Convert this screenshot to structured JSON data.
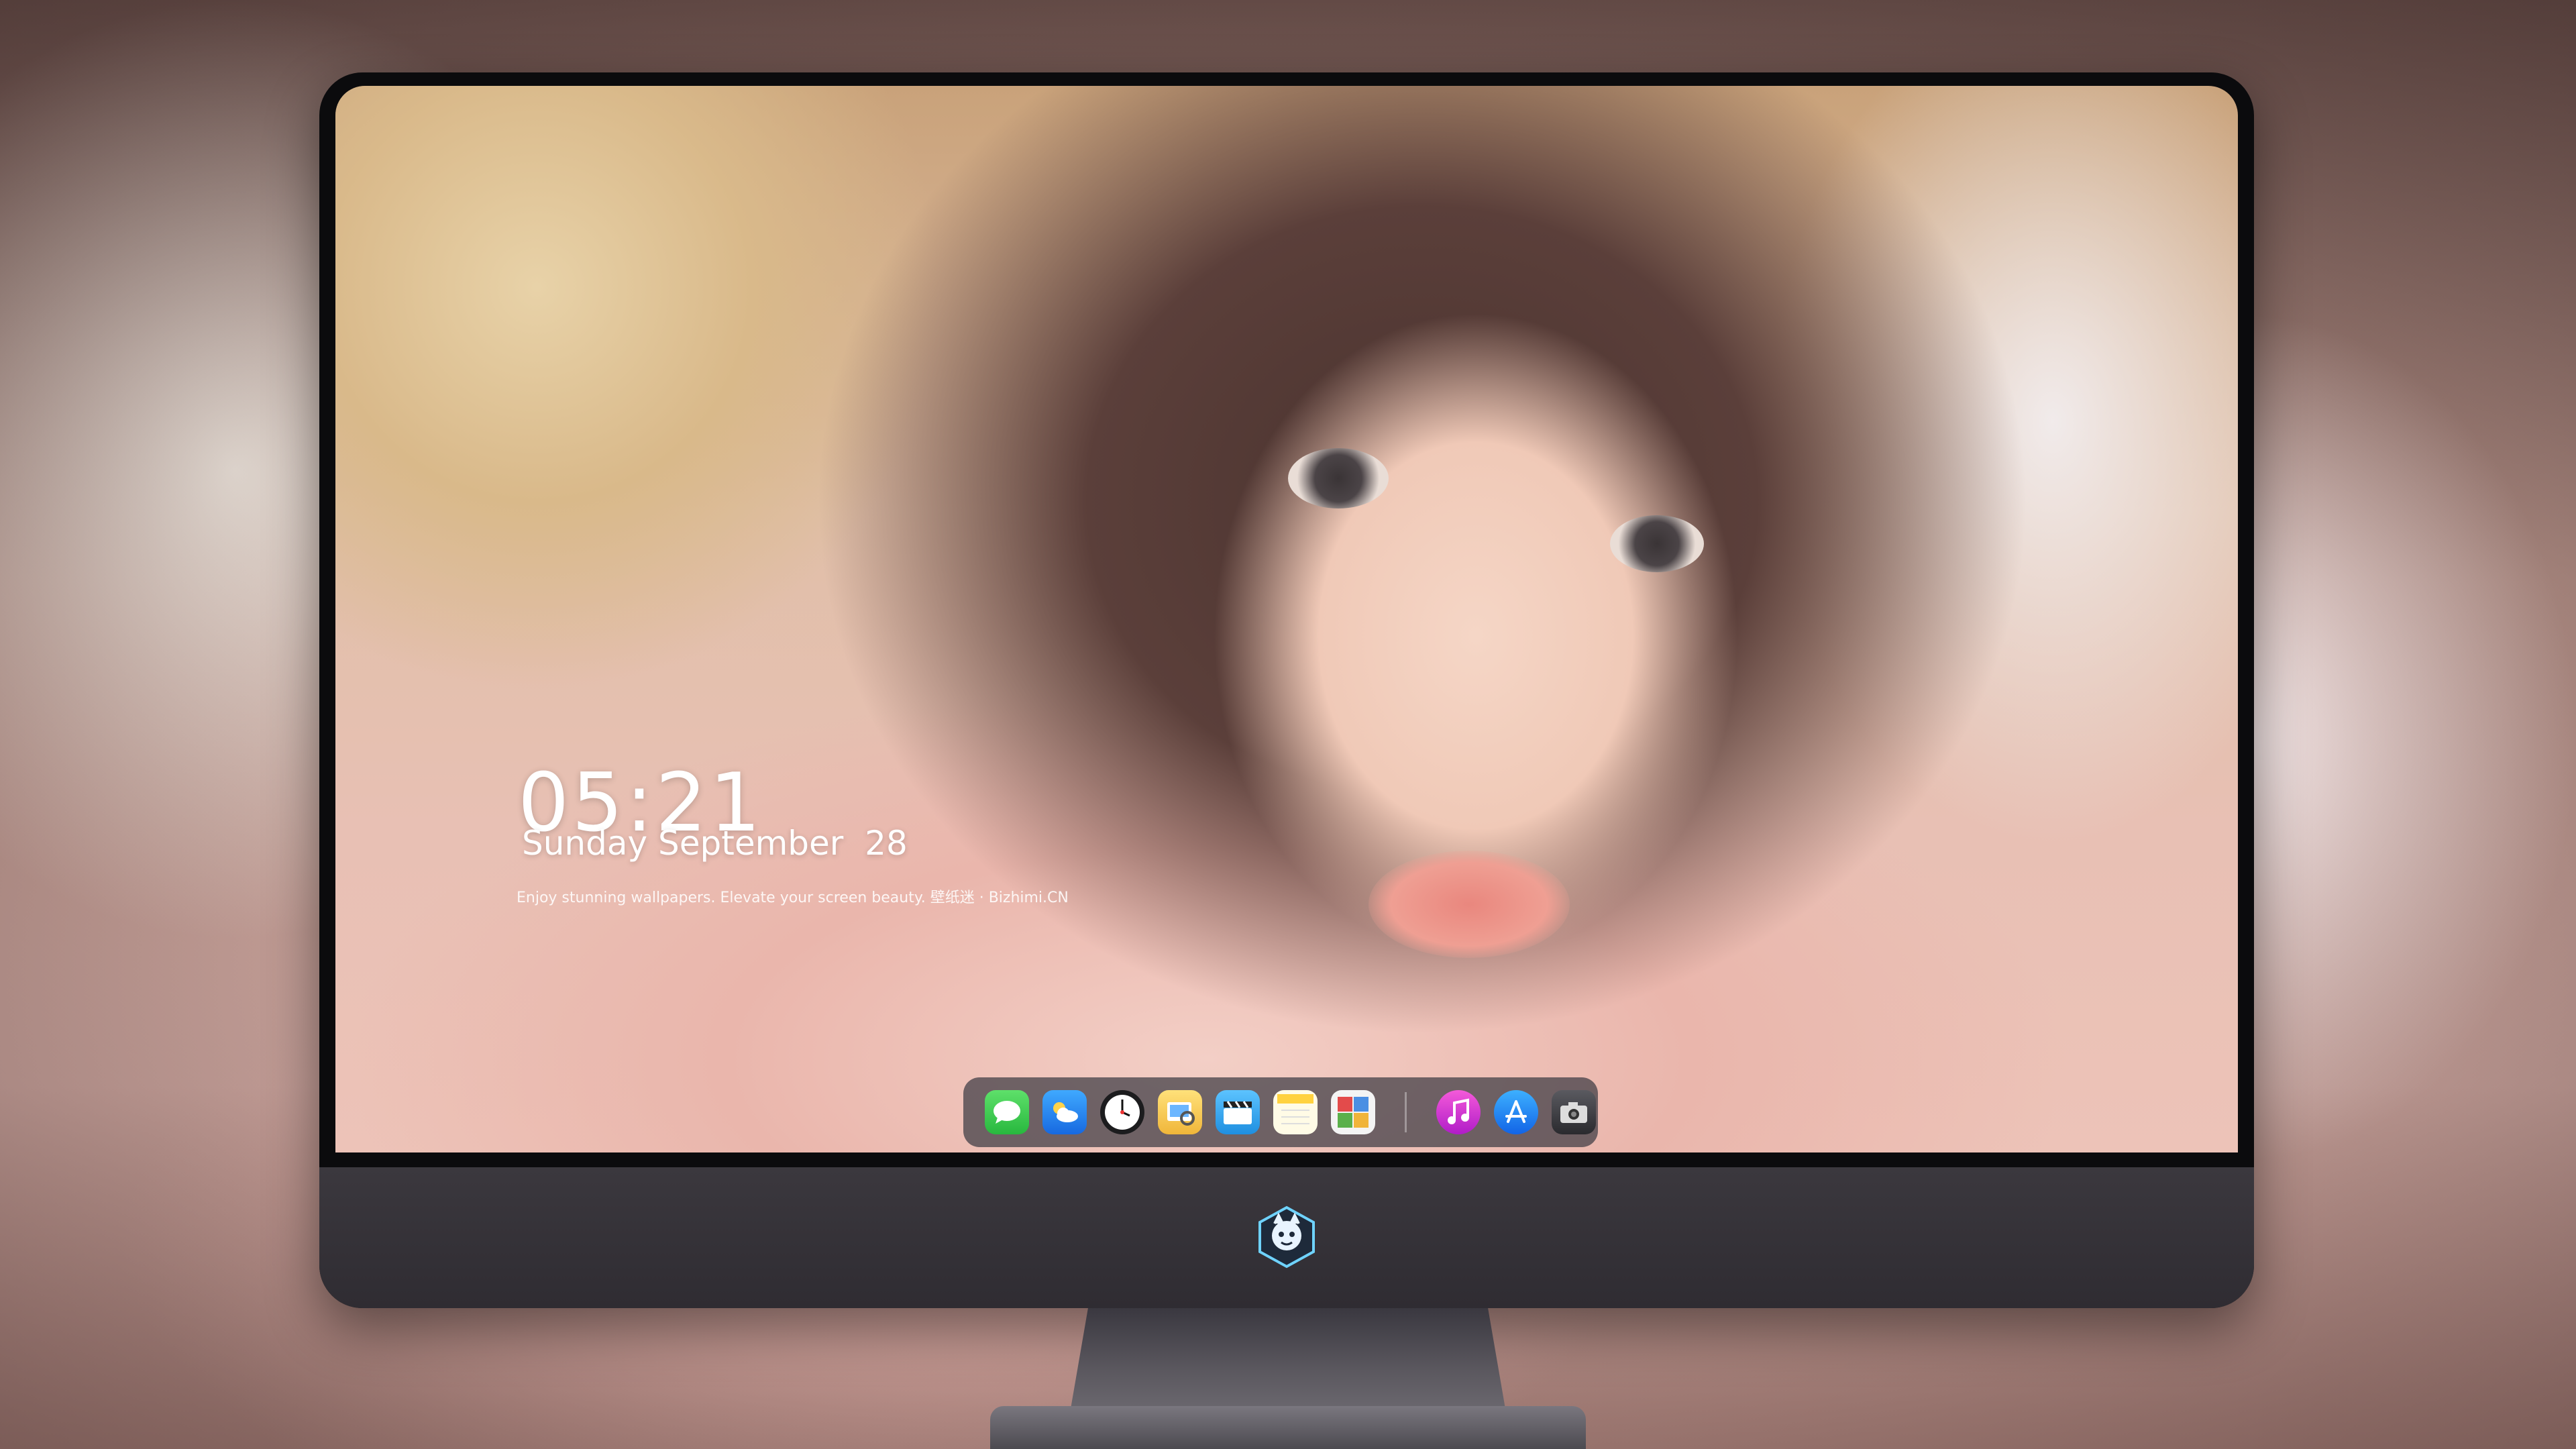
{
  "lock_screen": {
    "time": "05:21",
    "date": "Sunday September  28",
    "tagline": "Enjoy stunning wallpapers. Elevate your screen beauty. 壁纸迷 · Bizhimi.CN"
  },
  "dock": {
    "apps": [
      {
        "name": "messages-icon",
        "color": "#34c759"
      },
      {
        "name": "weather-icon",
        "color": "#1e90ff"
      },
      {
        "name": "clock-icon",
        "color": "#1c1c1e"
      },
      {
        "name": "preview-icon",
        "color": "#f4c542"
      },
      {
        "name": "claquette-icon",
        "color": "#34a8f0"
      },
      {
        "name": "notes-icon",
        "color": "#ffd23f"
      },
      {
        "name": "photo-booth-icon",
        "color": "#5a8f3c"
      }
    ],
    "right_apps": [
      {
        "name": "music-icon",
        "color": "#e12dd8"
      },
      {
        "name": "app-store-icon",
        "color": "#1a8cff"
      },
      {
        "name": "camera-icon",
        "color": "#2a2a2e"
      }
    ]
  },
  "colors": {
    "monitor_bezel": "#0b0b0d",
    "monitor_chin": "#3b383e",
    "dock_background": "#3c3a42"
  }
}
